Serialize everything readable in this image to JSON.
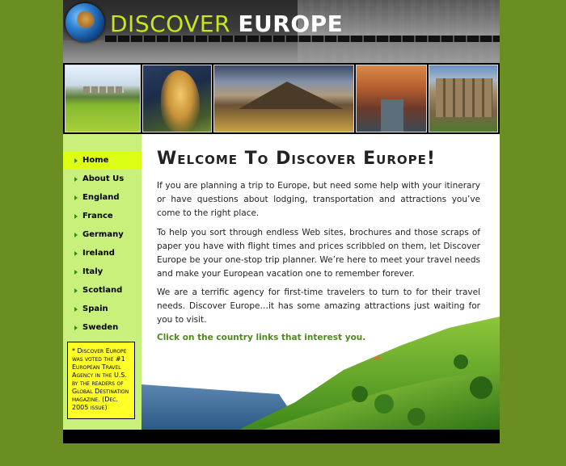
{
  "header": {
    "logo_word1": "Discover",
    "logo_word2": "Europe"
  },
  "sidebar": {
    "items": [
      {
        "label": "Home",
        "active": true
      },
      {
        "label": "About Us",
        "active": false
      },
      {
        "label": "England",
        "active": false
      },
      {
        "label": "France",
        "active": false
      },
      {
        "label": "Germany",
        "active": false
      },
      {
        "label": "Ireland",
        "active": false
      },
      {
        "label": "Italy",
        "active": false
      },
      {
        "label": "Scotland",
        "active": false
      },
      {
        "label": "Spain",
        "active": false
      },
      {
        "label": "Sweden",
        "active": false
      }
    ],
    "award_text": "* Discover Europe was voted the #1 European Travel Agency in the U.S. by the readers of Global Destination magazine. (Dec. 2005 issue)"
  },
  "main": {
    "title": "Welcome To Discover Europe!",
    "paragraphs": [
      "If you are planning a trip to Europe, but need some help with your itinerary or have questions about lodging, transportation and attractions you’ve come to the right place.",
      "To help you sort through endless Web sites, brochures and those scraps of paper you have with flight times and prices scribbled on them, let Discover Europe be your one-stop trip planner. We’re here to meet your travel needs and make your European vacation one to remember forever.",
      "We are a terrific agency for first-time travelers to turn to for their travel needs. Discover Europe…it has some amazing attractions just waiting for you to visit."
    ],
    "cta": "Click on the country links that interest you."
  },
  "colors": {
    "background": "#6b8e23",
    "sidebar": "#c8f07a",
    "nav_active": "#dcff14",
    "award_box": "#ffff28",
    "logo_accent": "#c8e619",
    "cta_text": "#4f8a1e"
  },
  "icons": [
    "globe-logo-icon",
    "nav-arrow-icon"
  ]
}
